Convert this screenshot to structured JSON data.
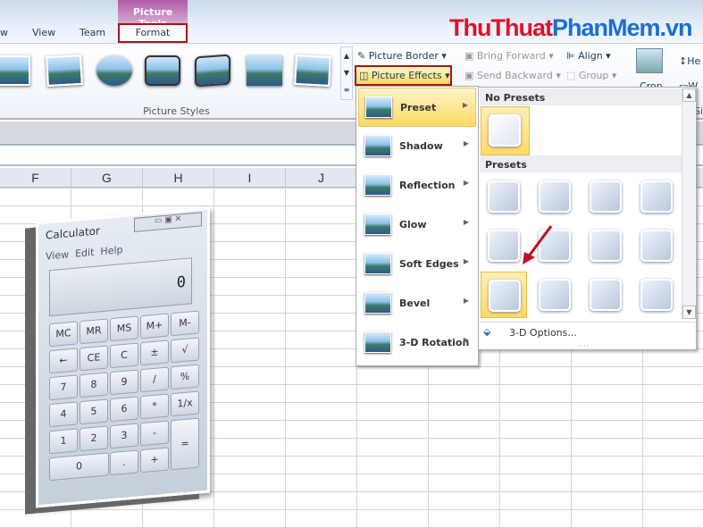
{
  "tabs": {
    "partial": "w",
    "view": "View",
    "team": "Team",
    "context_group": "Picture Tools",
    "format": "Format"
  },
  "watermark": {
    "part1": "ThuThuat",
    "part2": "PhanMem",
    "part3": ".vn"
  },
  "ribbon": {
    "group_label": "Picture Styles",
    "picture_border": "Picture Border",
    "picture_effects": "Picture Effects",
    "bring_forward": "Bring Forward",
    "send_backward": "Send Backward",
    "align": "Align",
    "group": "Group",
    "crop": "Crop",
    "height_partial": "He",
    "width_partial": "W",
    "size_partial": "Si"
  },
  "columns": [
    "F",
    "G",
    "H",
    "I",
    "J"
  ],
  "effects_menu": [
    {
      "label": "Preset",
      "selected": true
    },
    {
      "label": "Shadow"
    },
    {
      "label": "Reflection"
    },
    {
      "label": "Glow"
    },
    {
      "label": "Soft Edges"
    },
    {
      "label": "Bevel"
    },
    {
      "label": "3-D Rotation"
    }
  ],
  "preset_gallery": {
    "no_presets_header": "No Presets",
    "presets_header": "Presets",
    "preset_count": 12,
    "selected_preset": 9,
    "options": "3-D Options..."
  },
  "calculator": {
    "title": "Calculator",
    "menu": [
      "View",
      "Edit",
      "Help"
    ],
    "display": "0",
    "keys": [
      [
        "MC",
        "MR",
        "MS",
        "M+",
        "M-"
      ],
      [
        "←",
        "CE",
        "C",
        "±",
        "√"
      ],
      [
        "7",
        "8",
        "9",
        "/",
        "%"
      ],
      [
        "4",
        "5",
        "6",
        "*",
        "1/x"
      ],
      [
        "1",
        "2",
        "3",
        "-",
        "="
      ],
      [
        "0",
        ".",
        "+"
      ]
    ]
  },
  "colors": {
    "accent_red": "#b0101a",
    "context_purple": "#b05aa8",
    "highlight": "#ffd965"
  }
}
